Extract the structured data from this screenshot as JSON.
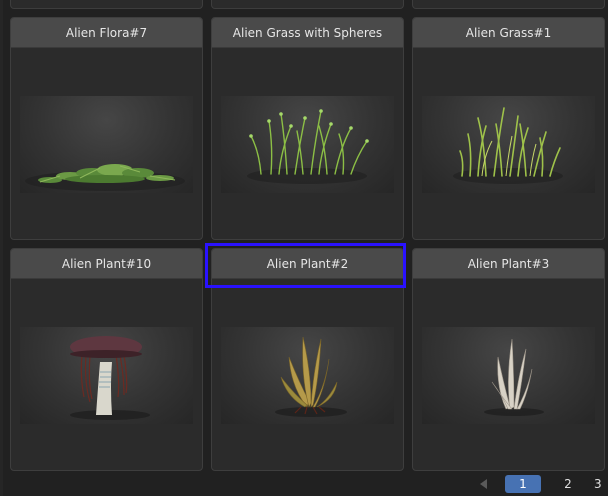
{
  "cards": [
    {
      "title": "Alien Flora#7"
    },
    {
      "title": "Alien Grass with Spheres"
    },
    {
      "title": "Alien Grass#1"
    },
    {
      "title": "Alien Plant#10"
    },
    {
      "title": "Alien Plant#2",
      "selected": true
    },
    {
      "title": "Alien Plant#3"
    }
  ],
  "pagination": {
    "pages": [
      "1",
      "2"
    ],
    "current": "1",
    "more": "3"
  },
  "colors": {
    "selection": "#2a12ff",
    "active_page": "#4772b3",
    "header": "#4a4a4a",
    "card": "#2b2b2b"
  }
}
